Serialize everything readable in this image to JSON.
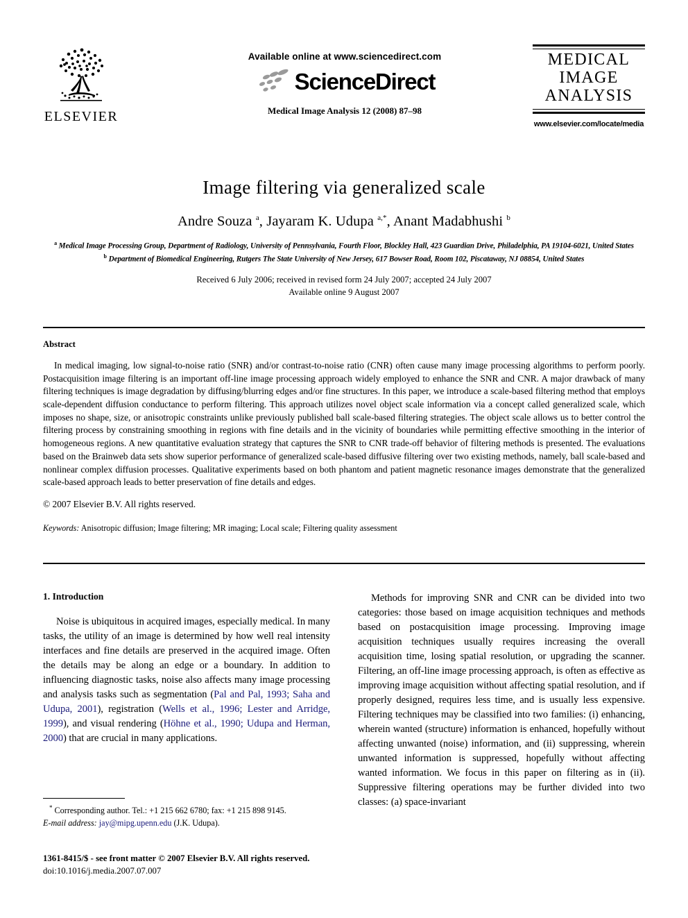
{
  "header": {
    "publisher_name": "ELSEVIER",
    "sciencedirect": {
      "available_line": "Available online at www.sciencedirect.com",
      "wordmark": "ScienceDirect",
      "journal_ref": "Medical Image Analysis 12 (2008) 87–98"
    },
    "journal_logo": {
      "line1": "MEDICAL",
      "line2": "IMAGE",
      "line3": "ANALYSIS",
      "url": "www.elsevier.com/locate/media"
    }
  },
  "article": {
    "title": "Image filtering via generalized scale",
    "authors_html": "Andre Souza <sup>a</sup>, Jayaram K. Udupa <sup>a,*</sup>, Anant Madabhushi <sup>b</sup>",
    "affiliations": [
      "Medical Image Processing Group, Department of Radiology, University of Pennsylvania, Fourth Floor, Blockley Hall, 423 Guardian Drive, Philadelphia, PA 19104-6021, United States",
      "Department of Biomedical Engineering, Rutgers The State University of New Jersey, 617 Bowser Road, Room 102, Piscataway, NJ 08854, United States"
    ],
    "affiliation_marks": [
      "a",
      "b"
    ],
    "dates_line1": "Received 6 July 2006; received in revised form 24 July 2007; accepted 24 July 2007",
    "dates_line2": "Available online 9 August 2007"
  },
  "abstract": {
    "heading": "Abstract",
    "body": "In medical imaging, low signal-to-noise ratio (SNR) and/or contrast-to-noise ratio (CNR) often cause many image processing algorithms to perform poorly. Postacquisition image filtering is an important off-line image processing approach widely employed to enhance the SNR and CNR. A major drawback of many filtering techniques is image degradation by diffusing/blurring edges and/or fine structures. In this paper, we introduce a scale-based filtering method that employs scale-dependent diffusion conductance to perform filtering. This approach utilizes novel object scale information via a concept called generalized scale, which imposes no shape, size, or anisotropic constraints unlike previously published ball scale-based filtering strategies. The object scale allows us to better control the filtering process by constraining smoothing in regions with fine details and in the vicinity of boundaries while permitting effective smoothing in the interior of homogeneous regions. A new quantitative evaluation strategy that captures the SNR to CNR trade-off behavior of filtering methods is presented. The evaluations based on the Brainweb data sets show superior performance of generalized scale-based diffusive filtering over two existing methods, namely, ball scale-based and nonlinear complex diffusion processes. Qualitative experiments based on both phantom and patient magnetic resonance images demonstrate that the generalized scale-based approach leads to better preservation of fine details and edges.",
    "copyright": "© 2007 Elsevier B.V. All rights reserved.",
    "keywords_label": "Keywords:",
    "keywords_value": "Anisotropic diffusion; Image filtering; MR imaging; Local scale; Filtering quality assessment"
  },
  "body": {
    "section_heading": "1. Introduction",
    "left_paragraph_parts": [
      {
        "text": "Noise is ubiquitous in acquired images, especially medical. In many tasks, the utility of an image is determined by how well real intensity interfaces and fine details are preserved in the acquired image. Often the details may be along an edge or a boundary. In addition to influencing diagnostic tasks, noise also affects many image processing and analysis tasks such as segmentation (",
        "cite": false
      },
      {
        "text": "Pal and Pal, 1993; Saha and Udupa, 2001",
        "cite": true
      },
      {
        "text": "), registration (",
        "cite": false
      },
      {
        "text": "Wells et al., 1996; Lester and Arridge, 1999",
        "cite": true
      },
      {
        "text": "), and visual rendering (",
        "cite": false
      },
      {
        "text": "Höhne et al., 1990; Udupa and Herman, 2000",
        "cite": true
      },
      {
        "text": ") that are crucial in many applications.",
        "cite": false
      }
    ],
    "right_paragraph": "Methods for improving SNR and CNR can be divided into two categories: those based on image acquisition techniques and methods based on postacquisition image processing. Improving image acquisition techniques usually requires increasing the overall acquisition time, losing spatial resolution, or upgrading the scanner. Filtering, an off-line image processing approach, is often as effective as improving image acquisition without affecting spatial resolution, and if properly designed, requires less time, and is usually less expensive. Filtering techniques may be classified into two families: (i) enhancing, wherein wanted (structure) information is enhanced, hopefully without affecting unwanted (noise) information, and (ii) suppressing, wherein unwanted information is suppressed, hopefully without affecting wanted information. We focus in this paper on filtering as in (ii). Suppressive filtering operations may be further divided into two classes: (a) space-invariant"
  },
  "footnote": {
    "marker": "*",
    "corresponding": "Corresponding author. Tel.: +1 215 662 6780; fax: +1 215 898 9145.",
    "email_label": "E-mail address:",
    "email": "jay@mipg.upenn.edu",
    "email_suffix": "(J.K. Udupa)."
  },
  "imprint": {
    "line1": "1361-8415/$ - see front matter © 2007 Elsevier B.V. All rights reserved.",
    "line2": "doi:10.1016/j.media.2007.07.007"
  },
  "colors": {
    "citation_link": "#1a1a7a",
    "text": "#000000",
    "background": "#ffffff"
  }
}
